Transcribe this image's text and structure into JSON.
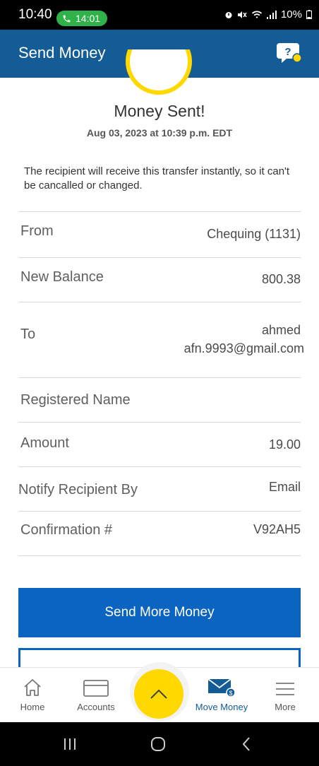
{
  "status_bar": {
    "time": "10:40",
    "call_duration": "14:01",
    "battery": "10%"
  },
  "header": {
    "title": "Send Money",
    "help_icon": "help-chat-icon"
  },
  "confirmation": {
    "title": "Money Sent!",
    "date": "Aug 03, 2023 at 10:39 p.m. EDT",
    "notice": "The recipient will receive this transfer instantly, so it can't be cancalled or changed."
  },
  "details": {
    "from_label": "From",
    "from_value": "Chequing (1131)",
    "balance_label": "New Balance",
    "balance_value": "800.38",
    "to_label": "To",
    "to_name": "ahmed",
    "to_email": "afn.9993@gmail.com",
    "registered_label": "Registered Name",
    "amount_label": "Amount",
    "amount_value": "19.00",
    "notify_label": "Notify Recipient By",
    "notify_value": "Email",
    "confirmation_label": "Confirmation #",
    "confirmation_value": "V92AH5"
  },
  "actions": {
    "send_more": "Send More Money"
  },
  "bottom_nav": {
    "home": "Home",
    "accounts": "Accounts",
    "move_money": "Move Money",
    "more": "More"
  },
  "colors": {
    "brand_blue": "#145c96",
    "button_blue": "#0b64bf",
    "accent_yellow": "#ffd800"
  }
}
